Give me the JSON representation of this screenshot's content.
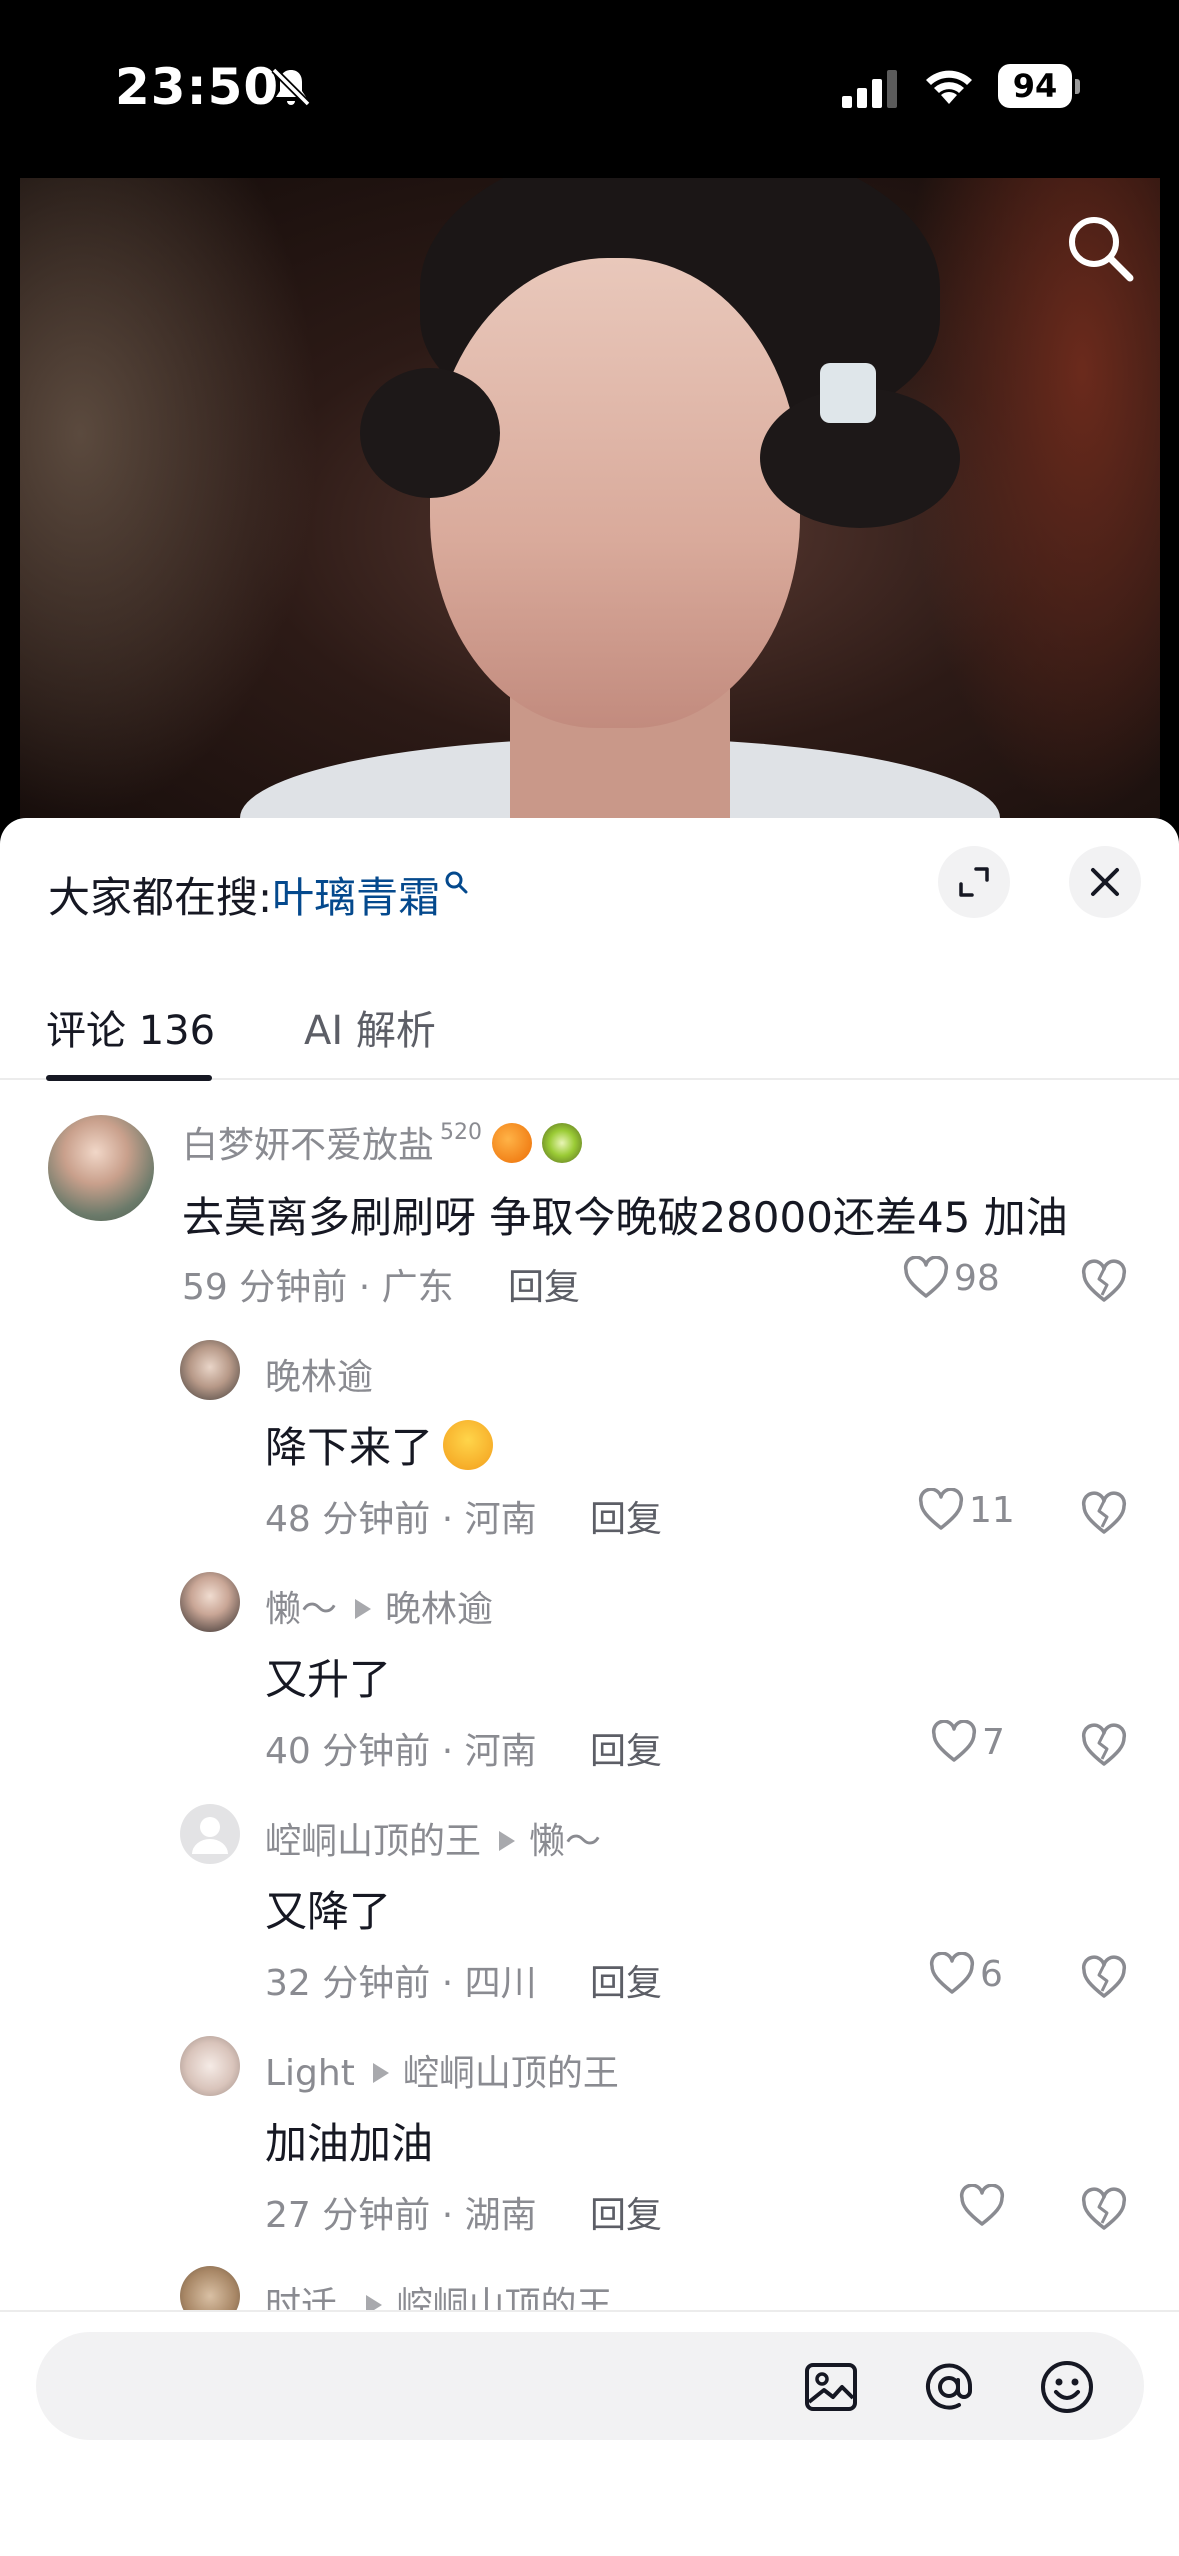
{
  "status_bar": {
    "time": "23:50",
    "battery": "94"
  },
  "search_suggest": {
    "prefix": "大家都在搜:",
    "query": "叶璃青霜"
  },
  "tabs": [
    {
      "label": "评论 136"
    },
    {
      "label": "AI 解析"
    }
  ],
  "comments": [
    {
      "name": "白梦妍不爱放盐",
      "sup": "520",
      "text": "去莫离多刷刷呀 争取今晚破28000还差45 加油",
      "meta": "59 分钟前 · 广东",
      "reply": "回复",
      "likes": "98"
    },
    {
      "name": "晚林逾",
      "text": "降下来了",
      "meta": "48 分钟前 · 河南",
      "reply": "回复",
      "likes": "11"
    },
    {
      "name": "懒～",
      "reply_to": "晚林逾",
      "text": "又升了",
      "meta": "40 分钟前 · 河南",
      "reply": "回复",
      "likes": "7"
    },
    {
      "name": "崆峒山顶的王",
      "reply_to": "懒～",
      "text": "又降了",
      "meta": "32 分钟前 · 四川",
      "reply": "回复",
      "likes": "6"
    },
    {
      "name": "Light",
      "reply_to": "崆峒山顶的王",
      "text": "加油加油",
      "meta": "27 分钟前 · 湖南",
      "reply": "回复",
      "likes": ""
    },
    {
      "name": "时迁.",
      "reply_to": "崆峒山顶的王"
    }
  ],
  "input": {
    "placeholder": ""
  },
  "icons": [
    "bell-slash-icon",
    "signal-icon",
    "wifi-icon",
    "search-icon",
    "expand-icon",
    "close-icon",
    "heart-icon",
    "broken-heart-icon",
    "image-icon",
    "at-icon",
    "emoji-icon"
  ],
  "colors": {
    "link": "#04498d",
    "text": "#161823",
    "muted": "#8a8b91"
  }
}
